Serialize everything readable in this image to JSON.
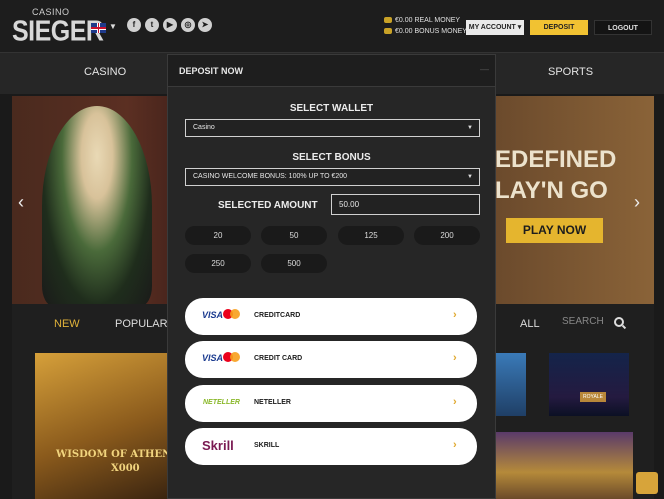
{
  "header": {
    "logo_small": "CASINO",
    "logo_big": "SIEGER",
    "real_money": "€0.00 REAL MONEY",
    "bonus_money": "€0.00 BONUS MONEY",
    "account_label": "MY ACCOUNT ▾",
    "deposit_label": "DEPOSIT",
    "logout_label": "LOGOUT",
    "social": [
      "f",
      "t",
      "▶",
      "◎",
      "➤"
    ]
  },
  "nav": {
    "casino": "CASINO",
    "sports": "SPORTS"
  },
  "hero": {
    "line1": "EDEFINED",
    "line2": "LAY'N GO",
    "play_label": "PLAY NOW"
  },
  "games": {
    "tab_new": "NEW",
    "tab_popular": "POPULAR",
    "tab_all": "ALL",
    "search_placeholder": "SEARCH",
    "tile1_title": "WISDOM OF ATHENA",
    "tile1_sub": "X000",
    "tile3_label": "ROYALE"
  },
  "modal": {
    "title": "DEPOSIT NOW",
    "close": "—",
    "wallet_label": "SELECT WALLET",
    "wallet_value": "Casino",
    "bonus_label": "SELECT BONUS",
    "bonus_value": "CASINO WELCOME BONUS: 100% UP TO €200",
    "amount_label": "SELECTED AMOUNT",
    "amount_value": "50.00",
    "amounts": [
      "20",
      "50",
      "125",
      "200",
      "250",
      "500"
    ],
    "methods": [
      {
        "logo": "VISA",
        "name": "CREDITCARD"
      },
      {
        "logo": "VISA",
        "name": "CREDIT CARD"
      },
      {
        "logo": "NETELLER",
        "name": "NETELLER"
      },
      {
        "logo": "Skrill",
        "name": "SKRILL"
      }
    ],
    "arrow": "›"
  },
  "colors": {
    "accent": "#f1c232",
    "modal_bg": "#262626",
    "page_bg": "#1a1a1a"
  }
}
